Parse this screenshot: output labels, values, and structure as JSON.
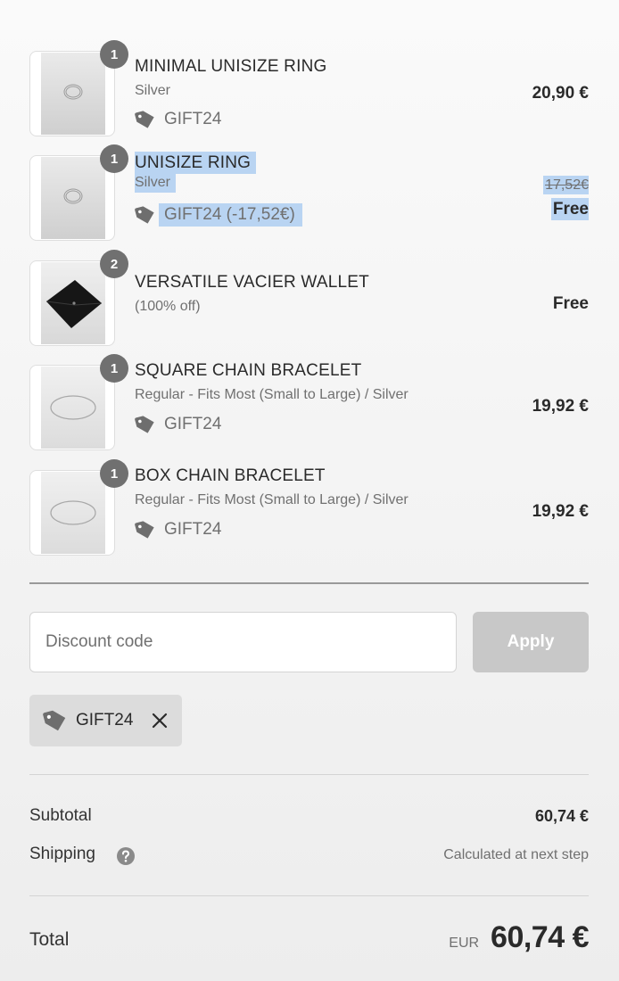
{
  "line_items": [
    {
      "quantity": "1",
      "title": "MINIMAL UNISIZE RING",
      "variant": "Silver",
      "discount": "GIFT24",
      "price": "20,90 €",
      "image": "silver-ring-photo"
    },
    {
      "quantity": "1",
      "title": "UNISIZE RING",
      "variant": "Silver",
      "discount": "GIFT24 (-17,52€)",
      "original_price": "17,52€",
      "price": "Free",
      "image": "silver-ring-photo"
    },
    {
      "quantity": "2",
      "title": "VERSATILE VACIER WALLET",
      "variant": "(100% off)",
      "price": "Free",
      "image": "black-wallet-photo"
    },
    {
      "quantity": "1",
      "title": "SQUARE CHAIN BRACELET",
      "variant": "Regular - Fits Most (Small to Large) / Silver",
      "discount": "GIFT24",
      "price": "19,92 €",
      "image": "chain-bracelet-photo"
    },
    {
      "quantity": "1",
      "title": "BOX CHAIN BRACELET",
      "variant": "Regular - Fits Most (Small to Large) / Silver",
      "discount": "GIFT24",
      "price": "19,92 €",
      "image": "chain-bracelet-photo"
    }
  ],
  "discount_form": {
    "placeholder": "Discount code",
    "value": "",
    "apply_label": "Apply"
  },
  "applied_code": {
    "code": "GIFT24",
    "remove_icon": "close-icon",
    "icon": "tag-icon"
  },
  "summary": {
    "subtotal_label": "Subtotal",
    "subtotal_value": "60,74 €",
    "shipping_label": "Shipping",
    "shipping_help_icon": "question-circle-icon",
    "shipping_value": "Calculated at next step",
    "total_label": "Total",
    "currency": "EUR",
    "total_value": "60,74 €"
  },
  "colors": {
    "selection_highlight": "#b9d4f2",
    "badge": "#707070",
    "apply_disabled": "#c8c8c8",
    "chip": "#dcdcdc"
  }
}
